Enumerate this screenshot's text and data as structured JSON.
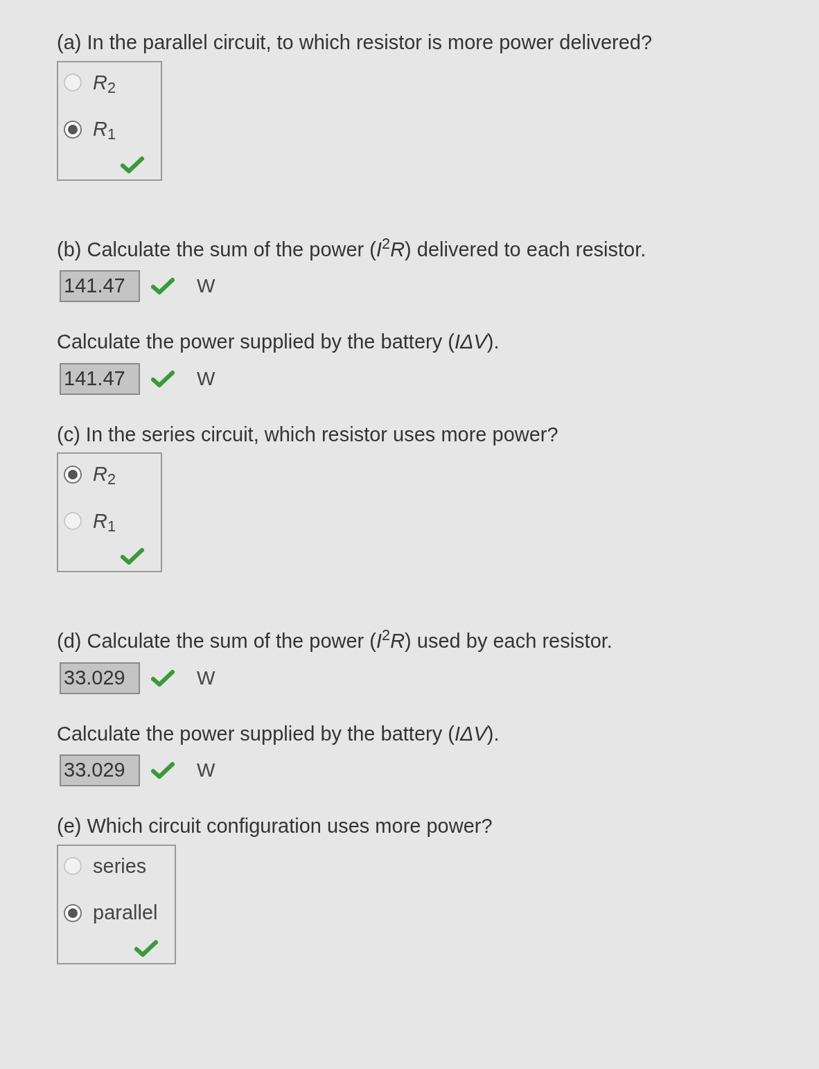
{
  "questions": [
    {
      "kind": "choice",
      "prompt": "(a) In the parallel circuit, to which resistor is more power delivered?",
      "options": [
        {
          "label": "*R*$_{2}$",
          "selected": false
        },
        {
          "label": "*R*$_{1}$",
          "selected": true
        }
      ],
      "correct": true
    },
    {
      "kind": "numeric",
      "prompt": "(b) Calculate the sum of the power (*I*$^{2}$*R*) delivered to each resistor.",
      "value": "141.47",
      "unit": "W",
      "correct": true
    },
    {
      "kind": "numeric",
      "prompt": "Calculate the power supplied by the battery (*IΔV*).",
      "value": "141.47",
      "unit": "W",
      "correct": true
    },
    {
      "kind": "choice",
      "prompt": "(c) In the series circuit, which resistor uses more power?",
      "options": [
        {
          "label": "*R*$_{2}$",
          "selected": true
        },
        {
          "label": "*R*$_{1}$",
          "selected": false
        }
      ],
      "correct": true
    },
    {
      "kind": "numeric",
      "prompt": "(d) Calculate the sum of the power (*I*$^{2}$*R*) used by each resistor.",
      "value": "33.029",
      "unit": "W",
      "correct": true
    },
    {
      "kind": "numeric",
      "prompt": "Calculate the power supplied by the battery (*IΔV*).",
      "value": "33.029",
      "unit": "W",
      "correct": true
    },
    {
      "kind": "choice",
      "prompt": "(e) Which circuit configuration uses more power?",
      "options": [
        {
          "label": "series",
          "selected": false
        },
        {
          "label": "parallel",
          "selected": true
        }
      ],
      "correct": true
    }
  ]
}
